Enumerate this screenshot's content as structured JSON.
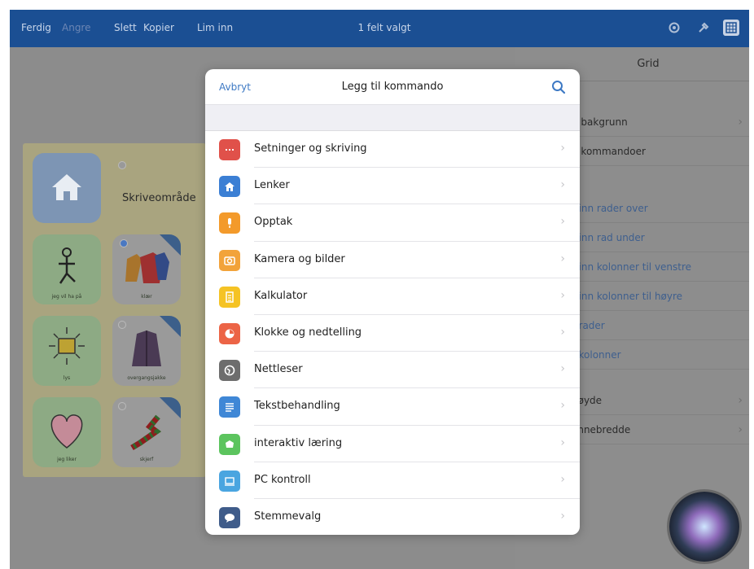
{
  "topbar": {
    "done": "Ferdig",
    "dim_item": "Angre",
    "delete": "Slett",
    "copy": "Kopier",
    "paste": "Lim inn",
    "title": "1 felt valgt"
  },
  "grid": {
    "writing_area_label": "Skriveområde",
    "cells": [
      {
        "label": "jeg vil ha på"
      },
      {
        "label": "klær"
      },
      {
        "label": "lys"
      },
      {
        "label": "overgangsjakke"
      },
      {
        "label": "jeg liker"
      },
      {
        "label": "skjerf"
      }
    ]
  },
  "panel": {
    "tab": "Grid",
    "rows": [
      "d bakgrunn",
      "d kommandoer",
      "t inn rader over",
      "t inn rad under",
      "t inn kolonner til venstre",
      "t inn kolonner til høyre",
      "t rader",
      "t kolonner",
      "høyde",
      "onnebredde"
    ]
  },
  "modal": {
    "cancel": "Avbryt",
    "title": "Legg til kommando",
    "items": [
      {
        "label": "Setninger og skriving",
        "icon": "sentence-icon",
        "color": "#e0514a"
      },
      {
        "label": "Lenker",
        "icon": "home-icon",
        "color": "#3b7fd4"
      },
      {
        "label": "Opptak",
        "icon": "microphone-icon",
        "color": "#f39a2b"
      },
      {
        "label": "Kamera og bilder",
        "icon": "camera-icon",
        "color": "#f2a33a"
      },
      {
        "label": "Kalkulator",
        "icon": "calculator-icon",
        "color": "#f5c324"
      },
      {
        "label": "Klokke og nedtelling",
        "icon": "clock-icon",
        "color": "#ec6446"
      },
      {
        "label": "Nettleser",
        "icon": "browser-icon",
        "color": "#6d6d6d"
      },
      {
        "label": "Tekstbehandling",
        "icon": "text-icon",
        "color": "#3f87d6"
      },
      {
        "label": "interaktiv læring",
        "icon": "learning-icon",
        "color": "#5cc45e"
      },
      {
        "label": "PC kontroll",
        "icon": "pc-icon",
        "color": "#4aa5e0"
      },
      {
        "label": "Stemmevalg",
        "icon": "speech-icon",
        "color": "#3f5c8a"
      }
    ]
  }
}
